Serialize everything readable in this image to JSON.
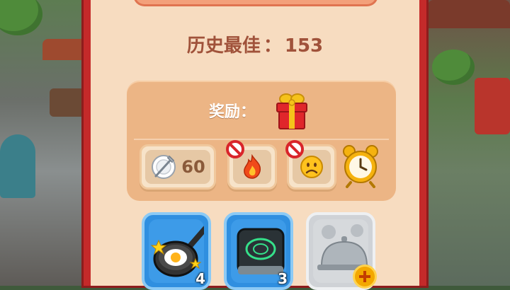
{
  "best_score": {
    "label": "历史最佳",
    "separator": "：",
    "value": "153"
  },
  "reward": {
    "label": "奖励：",
    "gift_icon": "gift-box-icon",
    "badges": [
      {
        "icon": "plate-fork-icon",
        "value": "60",
        "blocked": false
      },
      {
        "icon": "fire-icon",
        "blocked": true
      },
      {
        "icon": "sad-face-icon",
        "blocked": true
      },
      {
        "icon": "alarm-clock-icon",
        "blocked": false
      }
    ]
  },
  "boosters": [
    {
      "icon": "frying-pan-icon",
      "count": "4"
    },
    {
      "icon": "induction-cooker-icon",
      "count": "3"
    },
    {
      "icon": "serving-cloche-icon",
      "count": "",
      "add_button": "plus-icon"
    }
  ],
  "colors": {
    "panel_border": "#c42a2a",
    "panel_fill": "#f7dcc0",
    "score_text": "#a0523a",
    "reward_box": "#ecb585"
  }
}
